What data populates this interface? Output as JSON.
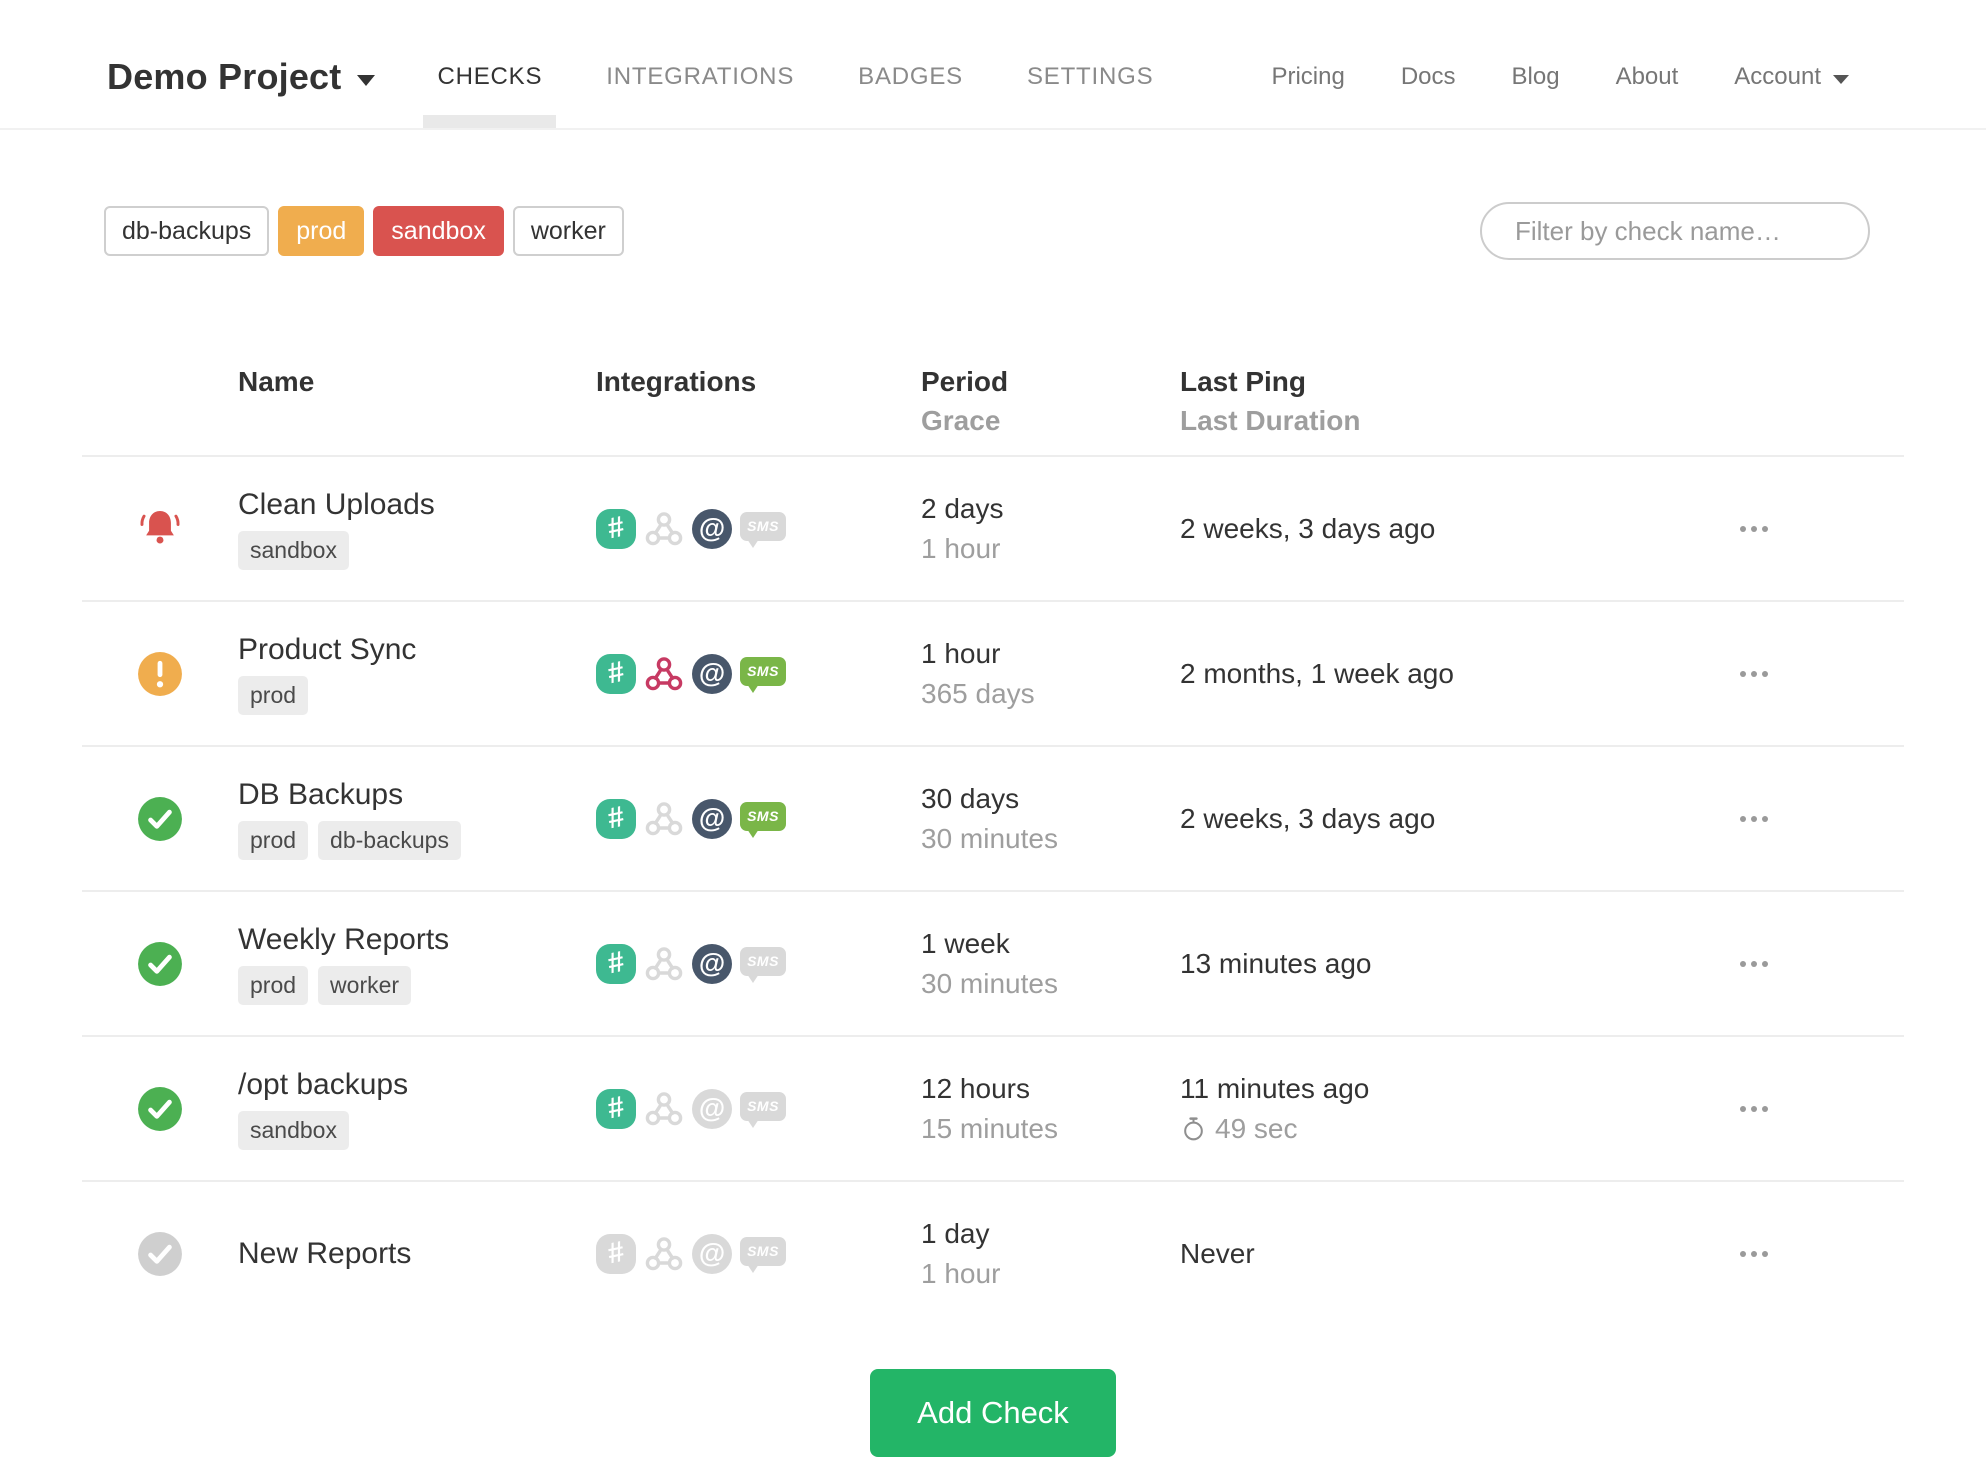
{
  "nav": {
    "project": "Demo Project",
    "tabs": [
      "CHECKS",
      "INTEGRATIONS",
      "BADGES",
      "SETTINGS"
    ],
    "links": [
      "Pricing",
      "Docs",
      "Blog",
      "About"
    ],
    "account": "Account"
  },
  "filters": {
    "tags": [
      {
        "label": "db-backups",
        "style": "outline"
      },
      {
        "label": "prod",
        "style": "orange"
      },
      {
        "label": "sandbox",
        "style": "red"
      },
      {
        "label": "worker",
        "style": "outline"
      }
    ],
    "search_placeholder": "Filter by check name…"
  },
  "table": {
    "headers": {
      "name": "Name",
      "integrations": "Integrations",
      "period": "Period",
      "grace": "Grace",
      "last_ping": "Last Ping",
      "last_duration": "Last Duration"
    },
    "rows": [
      {
        "status": "alert",
        "name": "Clean Uploads",
        "tags": [
          "sandbox"
        ],
        "integrations": {
          "slack": true,
          "webhook": false,
          "email": true,
          "sms": false
        },
        "period": "2 days",
        "grace": "1 hour",
        "last_ping": "2 weeks, 3 days ago",
        "last_duration": ""
      },
      {
        "status": "grace",
        "name": "Product Sync",
        "tags": [
          "prod"
        ],
        "integrations": {
          "slack": true,
          "webhook": true,
          "email": true,
          "sms": true
        },
        "period": "1 hour",
        "grace": "365 days",
        "last_ping": "2 months, 1 week ago",
        "last_duration": ""
      },
      {
        "status": "up",
        "name": "DB Backups",
        "tags": [
          "prod",
          "db-backups"
        ],
        "integrations": {
          "slack": true,
          "webhook": false,
          "email": true,
          "sms": true
        },
        "period": "30 days",
        "grace": "30 minutes",
        "last_ping": "2 weeks, 3 days ago",
        "last_duration": ""
      },
      {
        "status": "up",
        "name": "Weekly Reports",
        "tags": [
          "prod",
          "worker"
        ],
        "integrations": {
          "slack": true,
          "webhook": false,
          "email": true,
          "sms": false
        },
        "period": "1 week",
        "grace": "30 minutes",
        "last_ping": "13 minutes ago",
        "last_duration": ""
      },
      {
        "status": "up",
        "name": "/opt backups",
        "tags": [
          "sandbox"
        ],
        "integrations": {
          "slack": true,
          "webhook": false,
          "email": false,
          "sms": false
        },
        "period": "12 hours",
        "grace": "15 minutes",
        "last_ping": "11 minutes ago",
        "last_duration": "49 sec"
      },
      {
        "status": "new",
        "name": "New Reports",
        "tags": [],
        "integrations": {
          "slack": false,
          "webhook": false,
          "email": false,
          "sms": false
        },
        "period": "1 day",
        "grace": "1 hour",
        "last_ping": "Never",
        "last_duration": ""
      }
    ]
  },
  "footer": {
    "add_check_label": "Add Check"
  },
  "icons": {
    "status_alert": "bell",
    "status_grace": "exclamation-circle",
    "status_up": "check-circle",
    "status_new": "check-circle-muted",
    "integrations": [
      "slack",
      "webhook",
      "email",
      "sms"
    ],
    "last_duration": "stopwatch",
    "row_menu": "ellipsis",
    "project_caret": "chevron-down",
    "account_caret": "chevron-down"
  },
  "colors": {
    "alert_red": "#d9534f",
    "grace_orange": "#f0ad4e",
    "up_green": "#4cb052",
    "new_gray": "#cfcfcf",
    "slack_green": "#3eb991",
    "webhook_crimson": "#c73a63",
    "email_navy": "#48576b",
    "sms_green": "#7ab648",
    "inactive_icon": "#d9d9d9",
    "tag_orange": "#f0ad4e",
    "tag_red": "#d9534f",
    "add_check_green": "#23b567"
  }
}
